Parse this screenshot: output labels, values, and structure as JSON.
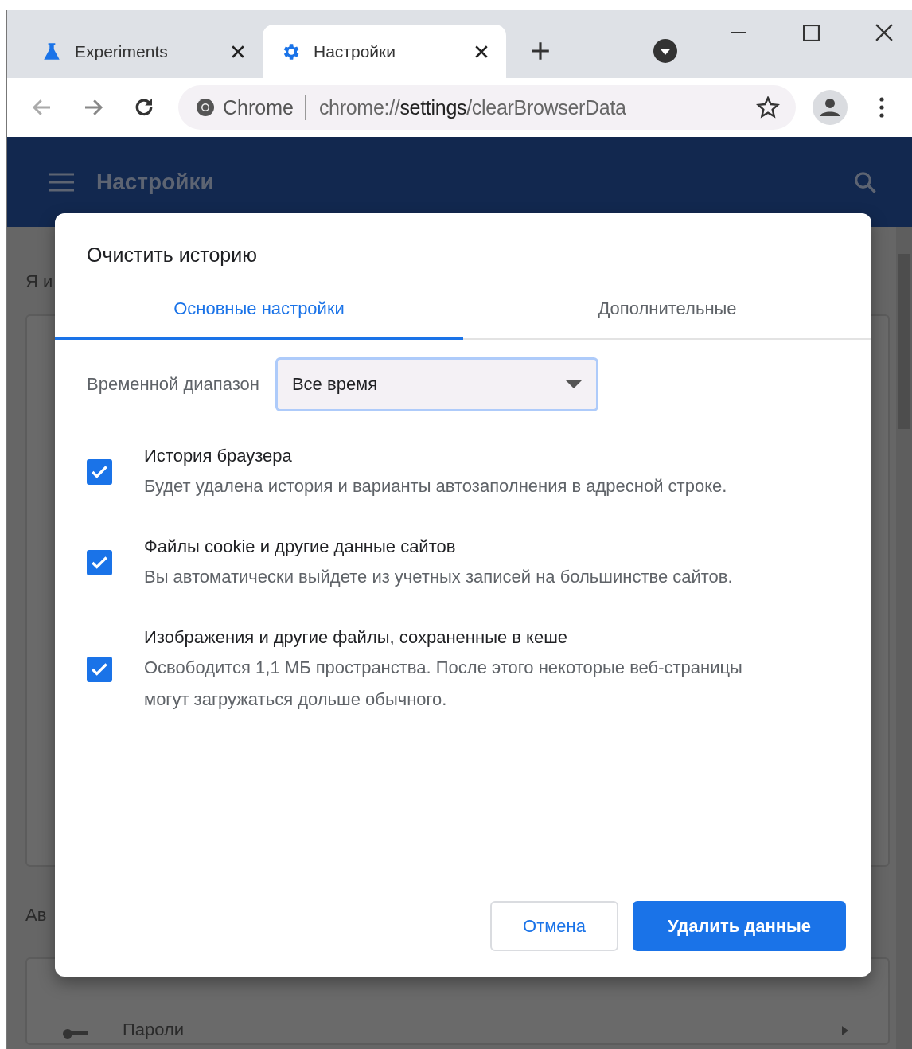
{
  "tabs": [
    {
      "title": "Experiments",
      "selected": false
    },
    {
      "title": "Настройки",
      "selected": true
    }
  ],
  "omnibox": {
    "site_label": "Chrome",
    "url": {
      "scheme": "chrome://",
      "host": "settings",
      "path": "/clearBrowserData"
    }
  },
  "header": {
    "title": "Настройки"
  },
  "background": {
    "section_1": "Я и",
    "section_2": "Ав",
    "row": "Пароли"
  },
  "dialog": {
    "title": "Очистить историю",
    "tabs": [
      {
        "label": "Основные настройки",
        "selected": true
      },
      {
        "label": "Дополнительные",
        "selected": false
      }
    ],
    "time_range": {
      "label": "Временной диапазон",
      "value": "Все время"
    },
    "items": [
      {
        "title": "История браузера",
        "description": "Будет удалена история и варианты автозаполнения в адресной строке.",
        "checked": true
      },
      {
        "title": "Файлы cookie и другие данные сайтов",
        "description": "Вы автоматически выйдете из учетных записей на большинстве сайтов.",
        "checked": true
      },
      {
        "title": "Изображения и другие файлы, сохраненные в кеше",
        "description": "Освободится 1,1 МБ пространства. После этого некоторые веб-страницы могут загружаться дольше обычного.",
        "checked": true
      }
    ],
    "buttons": [
      {
        "label": "Отмена",
        "kind": "secondary"
      },
      {
        "label": "Удалить данные",
        "kind": "primary"
      }
    ]
  }
}
